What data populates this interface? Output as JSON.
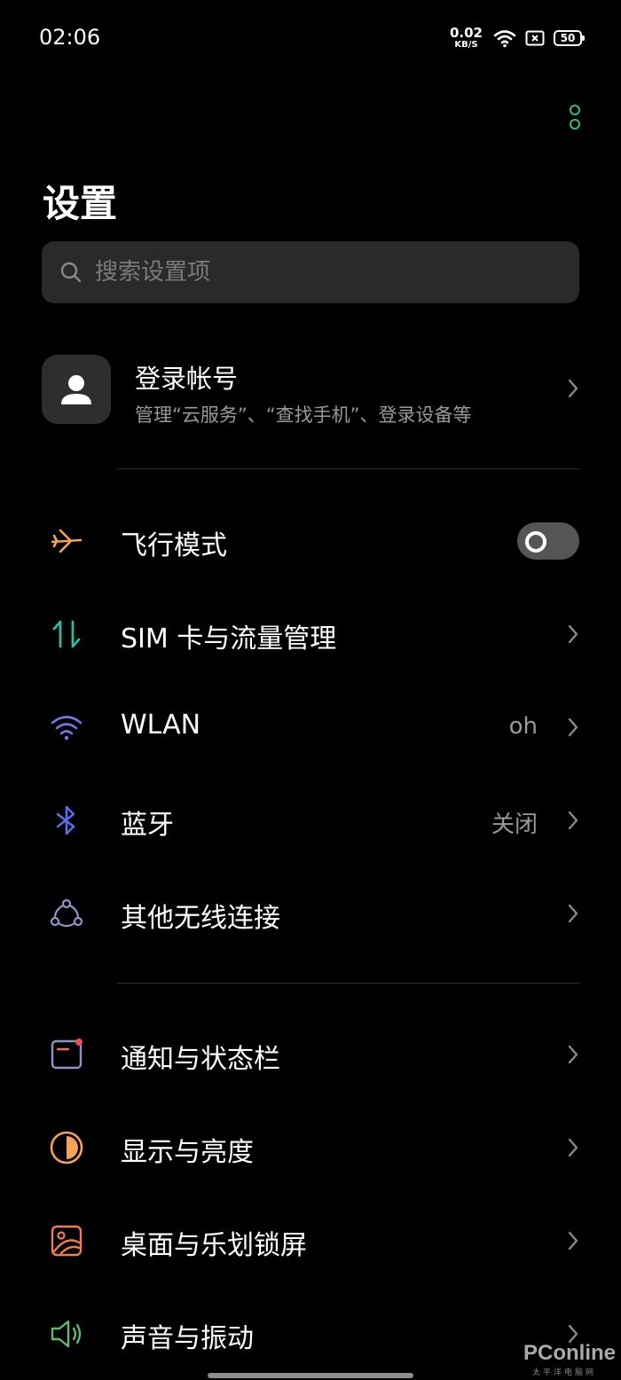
{
  "status_bar": {
    "time": "02:06",
    "net_speed_value": "0.02",
    "net_speed_unit": "KB/S",
    "battery": "50"
  },
  "page": {
    "title": "设置"
  },
  "search": {
    "placeholder": "搜索设置项"
  },
  "account": {
    "title": "登录帐号",
    "subtitle": "管理“云服务”、“查找手机”、登录设备等"
  },
  "settings": {
    "airplane": {
      "label": "飞行模式",
      "enabled": false
    },
    "sim": {
      "label": "SIM 卡与流量管理"
    },
    "wlan": {
      "label": "WLAN",
      "value": "oh"
    },
    "bluetooth": {
      "label": "蓝牙",
      "value": "关闭"
    },
    "other_wireless": {
      "label": "其他无线连接"
    },
    "notification": {
      "label": "通知与状态栏"
    },
    "display": {
      "label": "显示与亮度"
    },
    "desktop": {
      "label": "桌面与乐划锁屏"
    },
    "sound": {
      "label": "声音与振动"
    }
  },
  "watermark": {
    "text": "PConline",
    "sub": "太平洋电脑网"
  },
  "colors": {
    "accent_green": "#31c26f",
    "airplane_orange": "#f5a35b",
    "sim_teal": "#2dbba0",
    "wlan_blue": "#6f79e6",
    "bluetooth_blue": "#5870e6"
  }
}
